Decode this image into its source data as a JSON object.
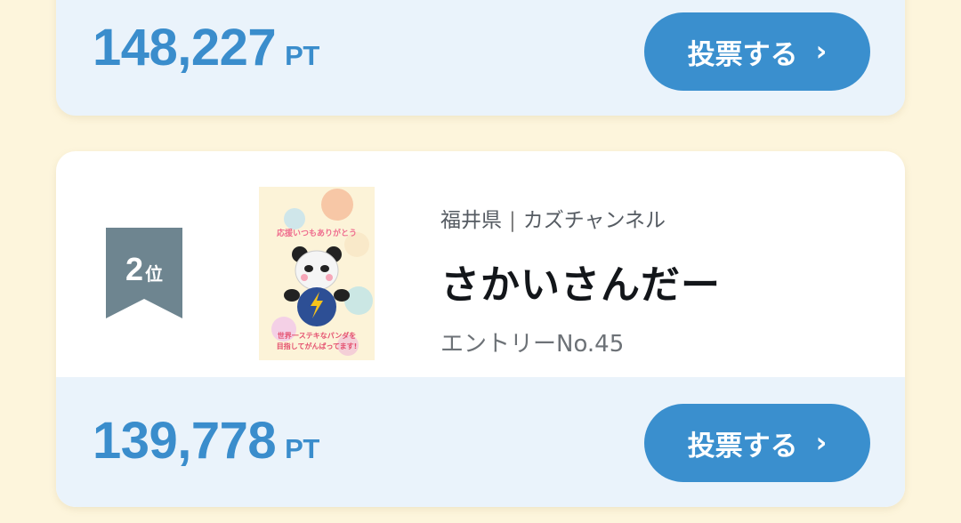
{
  "entries": [
    {
      "points": "148,227",
      "unit": "PT",
      "vote_label": "投票する",
      "chevron": "›"
    },
    {
      "rank_number": "2",
      "rank_suffix": "位",
      "prefecture": "福井県",
      "separator": "|",
      "channel": "カズチャンネル",
      "name": "さかいさんだー",
      "entry_no": "エントリーNo.45",
      "points": "139,778",
      "unit": "PT",
      "vote_label": "投票する",
      "chevron": "›",
      "thumbnail": {
        "icon": "panda-mascot-image",
        "top_text": "応援いつもありがとう",
        "bottom_text_1": "世界一ステキなパンダを",
        "bottom_text_2": "目指してがんばってます!"
      }
    }
  ],
  "colors": {
    "background": "#fdf5dc",
    "accent": "#3a8fce",
    "points": "#3a8dcc",
    "rank_badge": "#6e8590"
  }
}
